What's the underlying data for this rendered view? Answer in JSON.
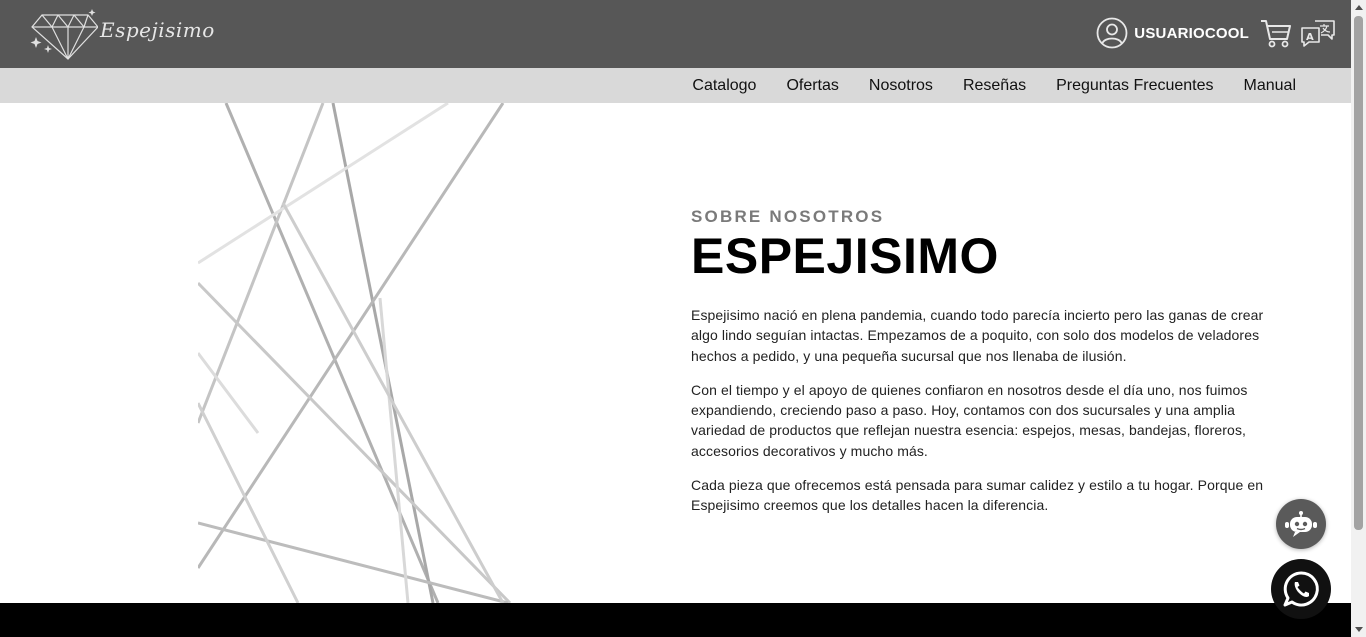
{
  "header": {
    "logo_text": "Espejisimo",
    "username": "USUARIOCOOL",
    "icons": [
      "diamond-logo-icon",
      "user-circle-icon",
      "cart-icon",
      "translate-icon"
    ]
  },
  "nav": {
    "items": [
      "Catalogo",
      "Ofertas",
      "Nosotros",
      "Reseñas",
      "Preguntas Frecuentes",
      "Manual"
    ]
  },
  "about": {
    "eyebrow": "SOBRE NOSOTROS",
    "title": "ESPEJISIMO",
    "paragraphs": [
      "Espejisimo nació en plena pandemia, cuando todo parecía incierto pero las ganas de crear algo lindo seguían intactas. Empezamos de a poquito, con solo dos modelos de veladores hechos a pedido, y una pequeña sucursal que nos llenaba de ilusión.",
      "Con el tiempo y el apoyo de quienes confiaron en nosotros desde el día uno, nos fuimos expandiendo, creciendo paso a paso. Hoy, contamos con dos sucursales y una amplia variedad de productos que reflejan nuestra esencia: espejos, mesas, bandejas, floreros, accesorios decorativos y mucho más.",
      "Cada pieza que ofrecemos está pensada para sumar calidez y estilo a tu hogar. Porque en Espejisimo creemos que los detalles hacen la diferencia."
    ]
  },
  "floating": {
    "chatbot_icon": "robot-icon",
    "whatsapp_icon": "whatsapp-icon"
  },
  "colors": {
    "header_bg": "#575757",
    "nav_bg": "#d9d9d9",
    "footer_bg": "#000000",
    "eyebrow": "#7a7a7a"
  }
}
